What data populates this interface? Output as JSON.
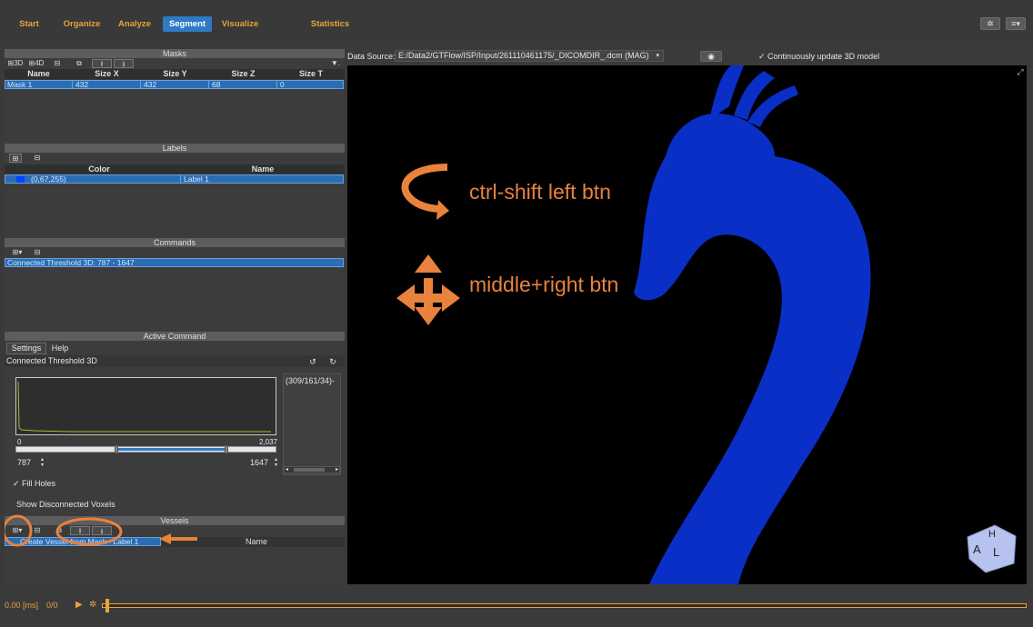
{
  "nav": {
    "tabs": [
      {
        "label": "Start",
        "active": false
      },
      {
        "label": "Organize",
        "active": false
      },
      {
        "label": "Analyze",
        "active": false
      },
      {
        "label": "Segment",
        "active": true
      },
      {
        "label": "Visualize",
        "active": false
      },
      {
        "label": "Statistics",
        "active": false
      }
    ],
    "settings_icon": "gears-icon",
    "menu_icon": "hamburger-menu-icon"
  },
  "masks": {
    "title": "Masks",
    "toolbar": {
      "add3d": "3D",
      "add4d": "4D",
      "filter_icon": "filter-icon"
    },
    "columns": [
      "Name",
      "Size X",
      "Size Y",
      "Size Z",
      "Size T"
    ],
    "rows": [
      [
        "Mask 1",
        "432",
        "432",
        "68",
        "0"
      ]
    ]
  },
  "labels": {
    "title": "Labels",
    "columns": [
      "Color",
      "Name"
    ],
    "rows": [
      {
        "color_text": "(0,67,255)",
        "swatch": "#0043ff",
        "name": "Label 1"
      }
    ]
  },
  "commands": {
    "title": "Commands",
    "items": [
      "Connected Threshold 3D: 787 - 1647"
    ]
  },
  "active_command": {
    "title": "Active Command",
    "tabs": [
      "Settings",
      "Help"
    ],
    "name": "Connected Threshold 3D",
    "histogram_min": "0",
    "histogram_max": "2,037",
    "seed_text": "(309/161/34)-",
    "lower_value": "787",
    "upper_value": "1647",
    "lower_fraction": 0.386,
    "upper_fraction": 0.809,
    "fill_holes_label": "Fill Holes",
    "fill_holes_checked": true,
    "show_disconnected_label": "Show Disconnected Voxels",
    "show_disconnected_checked": false
  },
  "vessels": {
    "title": "Vessels",
    "row_text": "Create Vessel from Mask - Label 1",
    "name_header": "Name"
  },
  "viewport": {
    "data_source_label": "Data Source:",
    "data_source_value": "E:/Data2/GTFlow/ISP/Input/261110461175/_DICOMDIR_.dcm (MAG)",
    "continuous_update_label": "Continuously update 3D model",
    "continuous_update_checked": true,
    "rotate_hint": "ctrl-shift left btn",
    "pan_hint": "middle+right btn",
    "vessel_color": "#0a2fc6",
    "accent_orange": "#e8823c",
    "cube_labels": [
      "H",
      "A",
      "L"
    ]
  },
  "timeline": {
    "time": "0.00 [ms]",
    "frame": "0/0"
  }
}
